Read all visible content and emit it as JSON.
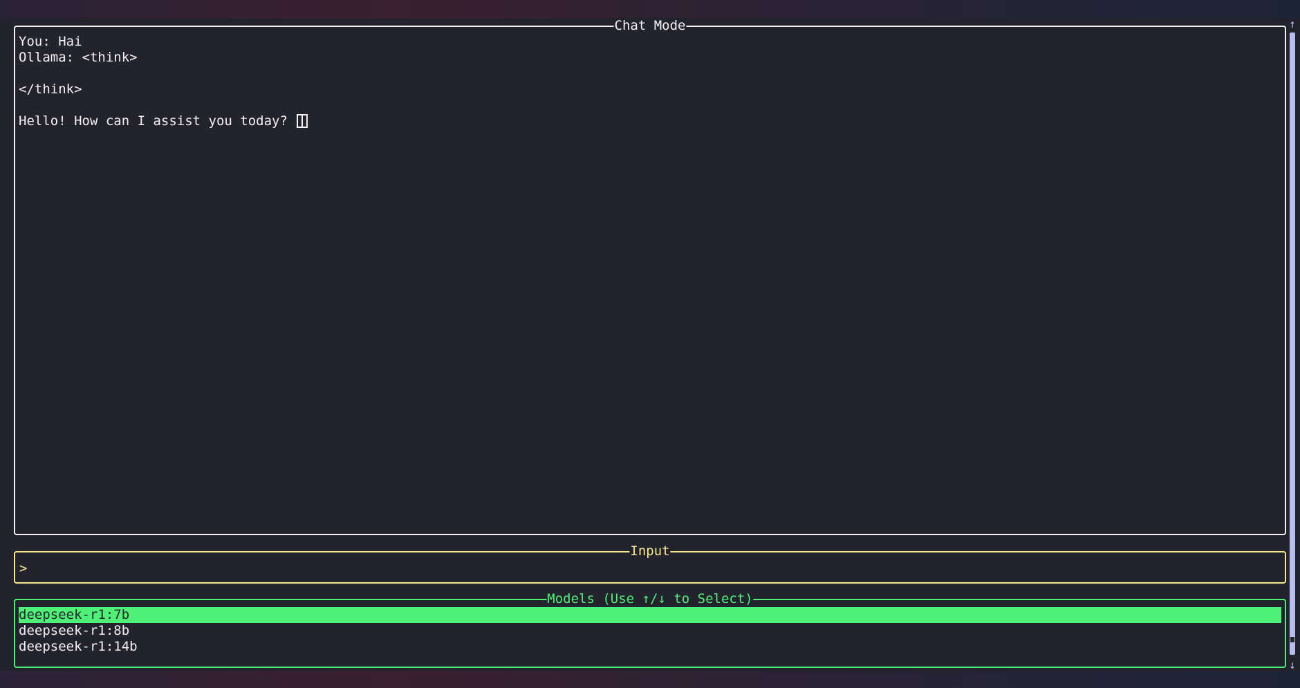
{
  "chat": {
    "title": "Chat Mode",
    "lines": [
      "You: Hai",
      "Ollama: <think>",
      "",
      "</think>",
      "",
      "Hello! How can I assist you today? "
    ]
  },
  "input": {
    "title": "Input",
    "prompt": ">"
  },
  "models": {
    "title": "Models (Use ↑/↓ to Select)",
    "items": [
      "deepseek-r1:7b",
      "deepseek-r1:8b",
      "deepseek-r1:14b"
    ],
    "selected_index": 0
  },
  "scrollbar": {
    "up_icon": "arrow-up-icon",
    "down_icon": "arrow-down-icon"
  },
  "colors": {
    "chat_border": "#f2f2f2",
    "input_accent": "#f5e98a",
    "models_accent": "#4ff078",
    "background": "#23232e",
    "scrollbar": "#b8bdf0"
  }
}
